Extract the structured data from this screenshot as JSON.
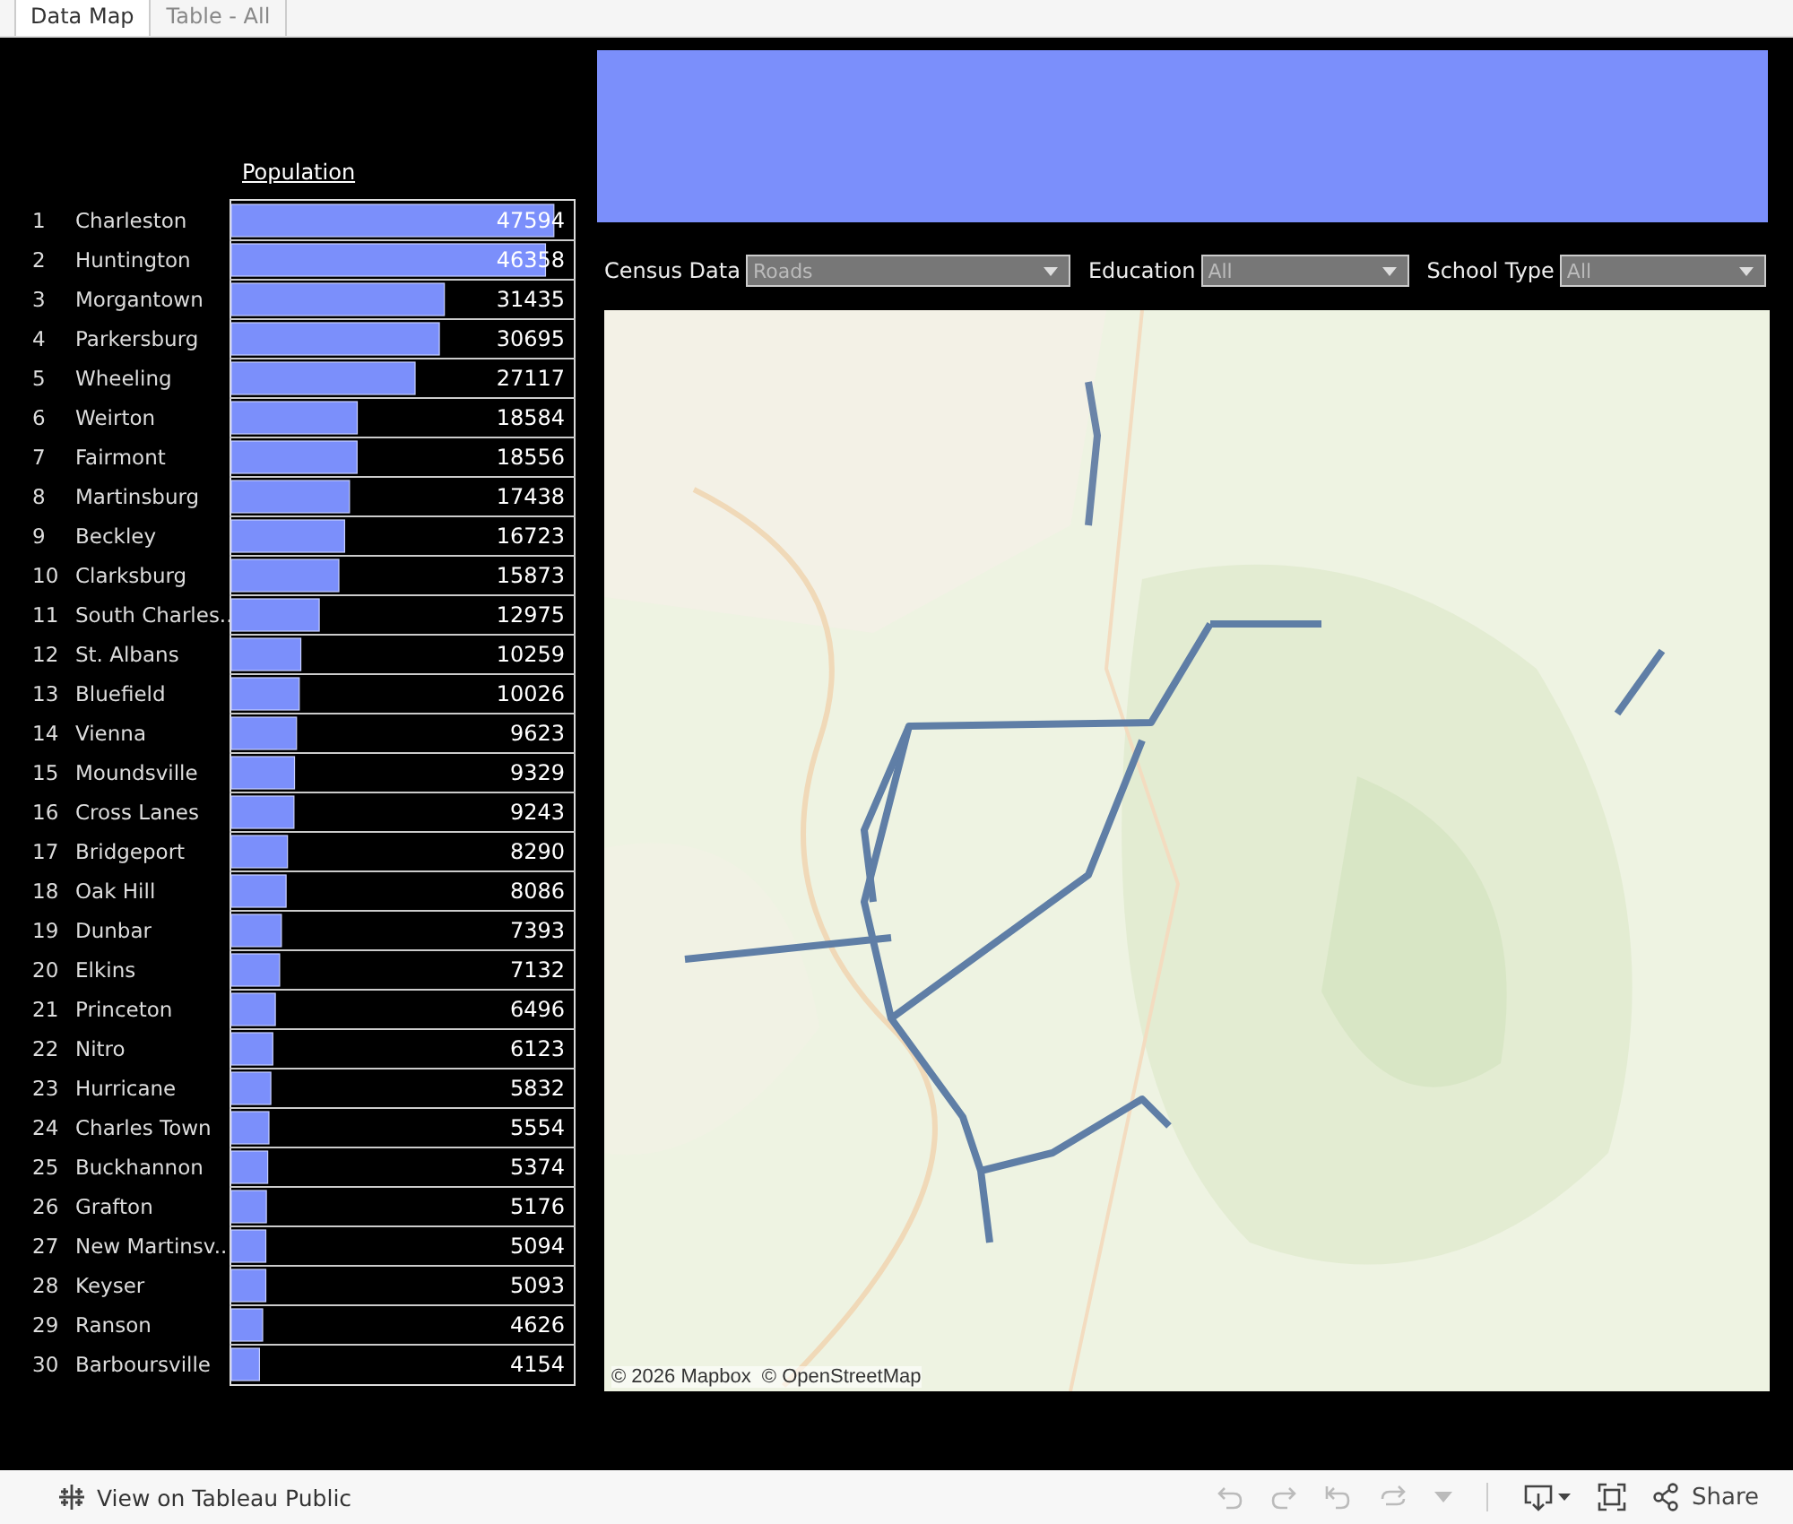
{
  "tabs": [
    {
      "label": "Data Map",
      "selected": true
    },
    {
      "label": "Table - All",
      "selected": false
    }
  ],
  "population_chart": {
    "ranks": [
      "1",
      "2",
      "3",
      "4",
      "5",
      "6",
      "7",
      "8",
      "9",
      "10",
      "11",
      "12",
      "13",
      "14",
      "15",
      "16",
      "17",
      "18",
      "19",
      "20",
      "21",
      "22",
      "23",
      "24",
      "25",
      "26",
      "27",
      "28",
      "29",
      "30"
    ],
    "chart_data": {
      "type": "bar",
      "orientation": "horizontal",
      "title": "Population",
      "data_labels": true,
      "categories": [
        "Charleston",
        "Huntington",
        "Morgantown",
        "Parkersburg",
        "Wheeling",
        "Weirton",
        "Fairmont",
        "Martinsburg",
        "Beckley",
        "Clarksburg",
        "South Charles..",
        "St. Albans",
        "Bluefield",
        "Vienna",
        "Moundsville",
        "Cross Lanes",
        "Bridgeport",
        "Oak Hill",
        "Dunbar",
        "Elkins",
        "Princeton",
        "Nitro",
        "Hurricane",
        "Charles Town",
        "Buckhannon",
        "Grafton",
        "New Martinsv..",
        "Keyser",
        "Ranson",
        "Barboursville"
      ],
      "series": [
        {
          "color": "#7b8ffb",
          "values": [
            47594,
            46358,
            31435,
            30695,
            27117,
            18584,
            18556,
            17438,
            16723,
            15873,
            12975,
            10259,
            10026,
            9623,
            9329,
            9243,
            8290,
            8086,
            7393,
            7132,
            6496,
            6123,
            5832,
            5554,
            5374,
            5176,
            5094,
            5093,
            4626,
            4154
          ]
        }
      ]
    }
  },
  "filters": [
    {
      "label": "Census Data",
      "value": "Roads"
    },
    {
      "label": "Education",
      "value": "All"
    },
    {
      "label": "School Type",
      "value": "All"
    }
  ],
  "map": {
    "kind": "picture",
    "attribution": "© 2026 Mapbox  © OpenStreetMap"
  },
  "toolbar": {
    "link": "View on Tableau Public",
    "buttons": [
      {
        "kind": "undo",
        "disabled": true
      },
      {
        "kind": "redo",
        "disabled": true
      },
      {
        "kind": "revert",
        "disabled": true
      },
      {
        "kind": "refresh",
        "disabled": true
      },
      {
        "kind": "caret",
        "disabled": true
      },
      {
        "kind": "download",
        "disabled": false
      },
      {
        "kind": "fullscreen",
        "disabled": false
      }
    ],
    "share": "Share"
  }
}
